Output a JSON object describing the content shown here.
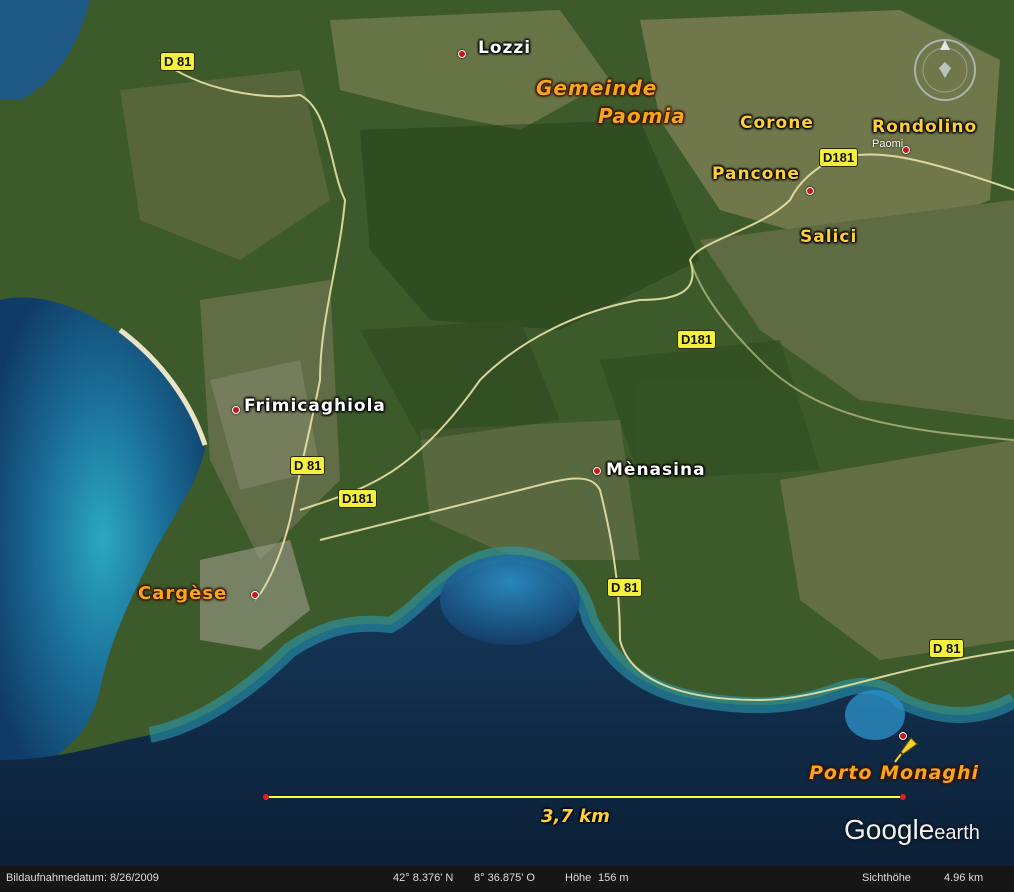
{
  "places": {
    "lozzi": "Lozzi",
    "frimicaghiola": "Frimicaghiola",
    "menasina": "Mènasina",
    "corone": "Corone",
    "rondolino": "Rondolino",
    "pancone": "Pancone",
    "salici": "Salici",
    "paomia_small": "Paomi",
    "gemeinde_line1": "Gemeinde",
    "gemeinde_line2": "Paomia",
    "cargese": "Cargèse",
    "porto_monaghi": "Porto Monaghi"
  },
  "roads": {
    "d81": "D 81",
    "d181": "D181"
  },
  "scale": {
    "distance": "3,7 km"
  },
  "logo": {
    "google": "Google",
    "earth": "earth"
  },
  "status": {
    "imagery_date": "Bildaufnahmedatum: 8/26/2009",
    "lat": "42° 8.376' N",
    "lon": "8° 36.875' O",
    "elevation_label": "Höhe",
    "elevation": "156 m",
    "eye_alt_label": "Sichthöhe",
    "eye_alt": "4.96 km"
  },
  "colors": {
    "sea_deep": "#0e2a48",
    "sea_shallow": "#2aa6b8",
    "land": "#3f5e2c",
    "road": "#f4f03c",
    "label_orange": "#f7a51d",
    "label_yellow": "#ffcf3a",
    "scale_line": "#ffff44"
  },
  "icons": [
    "compass-icon",
    "pushpin-icon",
    "place-marker-icon"
  ]
}
